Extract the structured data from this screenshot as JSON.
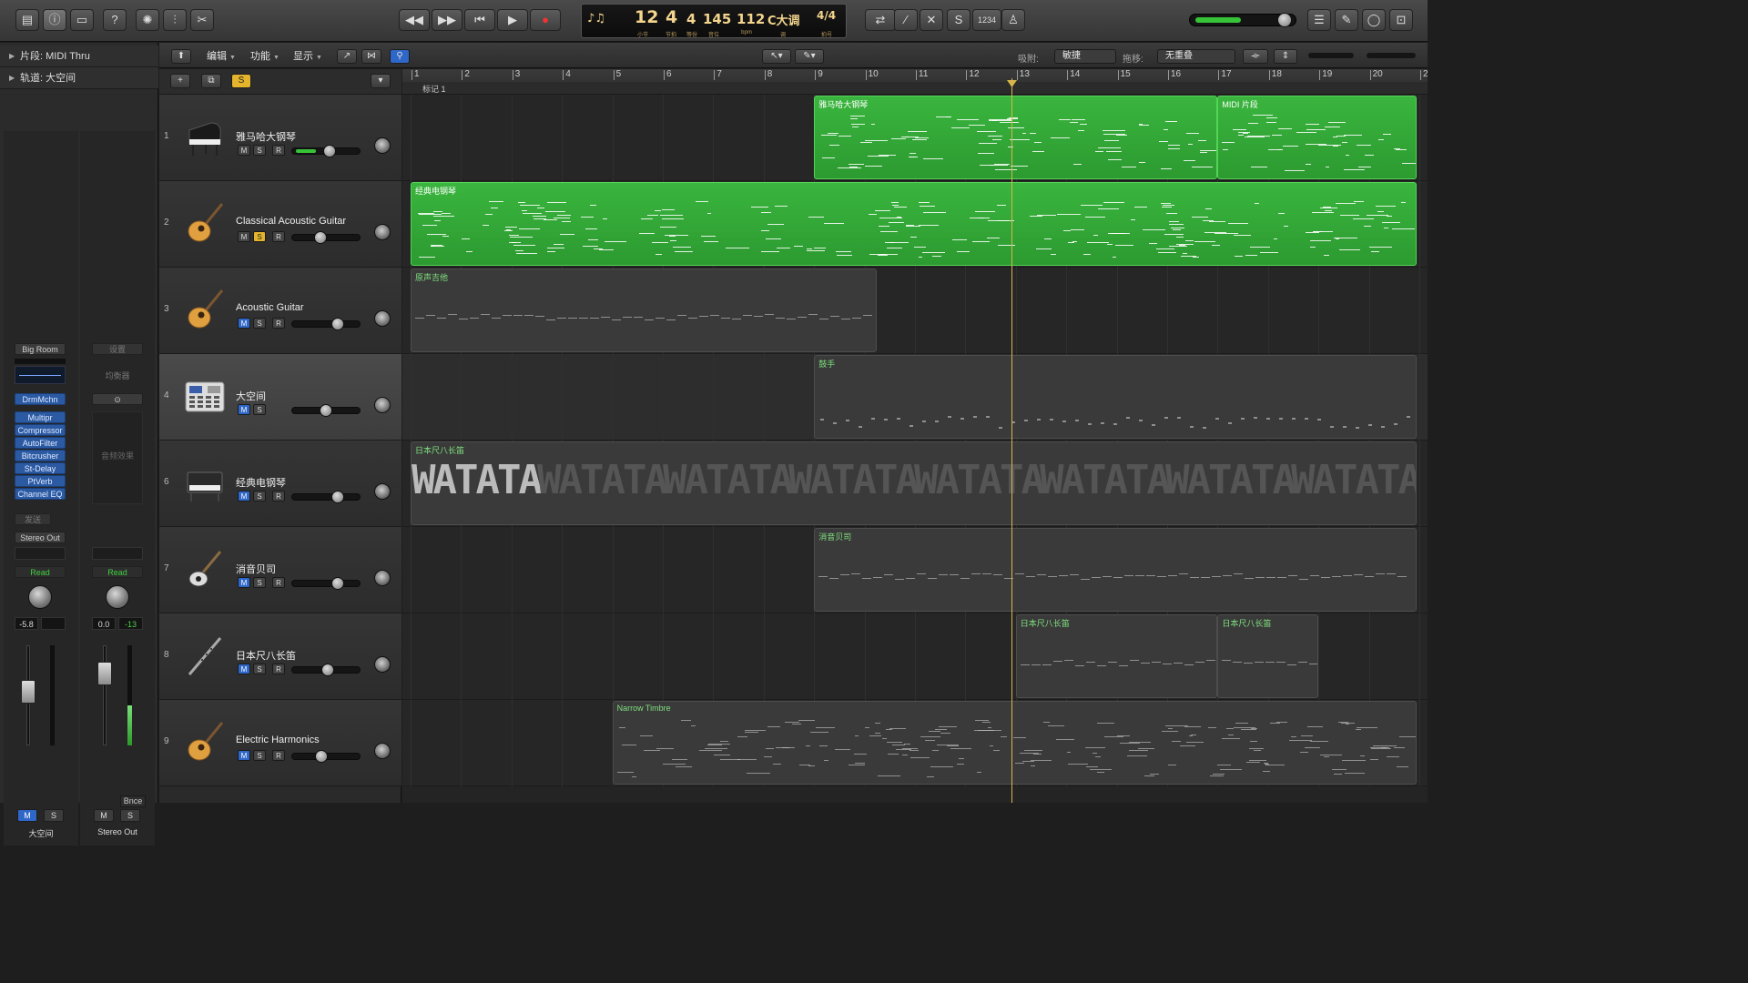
{
  "toolbar": {
    "lcd": {
      "bar": "12",
      "beat": "4",
      "division": "4",
      "tick": "145",
      "bpm": "112",
      "key": "C大调",
      "signature": "4/4",
      "bar_label": "小节",
      "beat_label": "节拍",
      "division_label": "等份",
      "tick_label": "音位",
      "bpm_label": "bpm",
      "key_label": "调",
      "signature_label": "拍号",
      "counter": "1234"
    }
  },
  "inspector": {
    "region_row": "片段: MIDI Thru",
    "track_row": "轨道: 大空间",
    "strip1": {
      "setting": "Big Room",
      "instrument": "DrmMchn",
      "plugins": [
        "Multipr",
        "Compressor",
        "AutoFilter",
        "Bitcrusher",
        "St-Delay",
        "PtVerb",
        "Channel EQ"
      ],
      "send": "发送",
      "output": "Stereo Out",
      "automation": "Read",
      "volume": "-5.8",
      "mute": "M",
      "solo": "S",
      "name": "大空间"
    },
    "strip2": {
      "setting": "设置",
      "eq": "均衡器",
      "fx": "音频效果",
      "automation": "Read",
      "volume": "0.0",
      "peak": "-13",
      "bounce": "Bnce",
      "mute": "M",
      "solo": "S",
      "name": "Stereo Out"
    }
  },
  "arrange_header": {
    "menus": [
      "编辑",
      "功能",
      "显示"
    ],
    "snap_label": "吸附:",
    "snap_value": "敏捷",
    "drag_label": "拖移:",
    "drag_value": "无重叠",
    "global_solo": "S",
    "marker": "标记 1"
  },
  "ruler": [
    "1",
    "2",
    "3",
    "4",
    "5",
    "6",
    "7",
    "8",
    "9",
    "10",
    "11",
    "12",
    "13",
    "14",
    "15",
    "16",
    "17",
    "18",
    "19",
    "20",
    "2"
  ],
  "tracks": [
    {
      "num": "1",
      "name": "雅马哈大钢琴",
      "icon": "grand-piano-icon",
      "m": "M",
      "s": "S",
      "r": "R",
      "mute_on": false,
      "solo_on": false,
      "vol": 0.55
    },
    {
      "num": "2",
      "name": "Classical Acoustic Guitar",
      "icon": "acoustic-guitar-icon",
      "m": "M",
      "s": "S",
      "r": "R",
      "mute_on": false,
      "solo_on": true,
      "vol": 0.38
    },
    {
      "num": "3",
      "name": "Acoustic Guitar",
      "icon": "acoustic-guitar-icon",
      "m": "M",
      "s": "S",
      "r": "R",
      "mute_on": true,
      "solo_on": false,
      "vol": 0.7
    },
    {
      "num": "4",
      "name": "大空间",
      "icon": "drum-machine-icon",
      "m": "M",
      "s": "S",
      "r": "",
      "mute_on": true,
      "solo_on": false,
      "vol": 0.48
    },
    {
      "num": "6",
      "name": "经典电钢琴",
      "icon": "electric-piano-icon",
      "m": "M",
      "s": "S",
      "r": "R",
      "mute_on": true,
      "solo_on": false,
      "vol": 0.7
    },
    {
      "num": "7",
      "name": "消音贝司",
      "icon": "bass-guitar-icon",
      "m": "M",
      "s": "S",
      "r": "R",
      "mute_on": true,
      "solo_on": false,
      "vol": 0.7
    },
    {
      "num": "8",
      "name": "日本尺八长笛",
      "icon": "shakuhachi-icon",
      "m": "M",
      "s": "S",
      "r": "R",
      "mute_on": true,
      "solo_on": false,
      "vol": 0.52
    },
    {
      "num": "9",
      "name": "Electric Harmonics",
      "icon": "acoustic-guitar-icon",
      "m": "M",
      "s": "S",
      "r": "R",
      "mute_on": true,
      "solo_on": false,
      "vol": 0.4
    }
  ],
  "regions": [
    {
      "lane": 0,
      "name": "雅马哈大钢琴",
      "start": 9,
      "end": 17,
      "color": "green"
    },
    {
      "lane": 0,
      "name": "MIDI 片段",
      "start": 17,
      "end": 21,
      "color": "green"
    },
    {
      "lane": 1,
      "name": "经典电钢琴",
      "start": 1,
      "end": 21,
      "color": "green"
    },
    {
      "lane": 2,
      "name": "原声吉他",
      "start": 1,
      "end": 10.25,
      "color": "grey"
    },
    {
      "lane": 3,
      "name": "鼓手",
      "start": 9,
      "end": 21,
      "color": "grey"
    },
    {
      "lane": 4,
      "name": "日本尺八长笛",
      "start": 1,
      "end": 21,
      "color": "grey"
    },
    {
      "lane": 5,
      "name": "消音贝司",
      "start": 9,
      "end": 21,
      "color": "grey"
    },
    {
      "lane": 6,
      "name": "日本尺八长笛",
      "start": 13,
      "end": 17,
      "color": "grey"
    },
    {
      "lane": 6,
      "name": "日本尺八长笛",
      "start": 17,
      "end": 19,
      "color": "grey"
    },
    {
      "lane": 7,
      "name": "Narrow Timbre",
      "start": 5,
      "end": 21,
      "color": "grey"
    }
  ],
  "watermark_text": "WATATA",
  "colors": {
    "region_green": "#34a838",
    "playhead": "#d6b64a",
    "solo": "#e4b42c",
    "mute": "#2f67c8"
  }
}
